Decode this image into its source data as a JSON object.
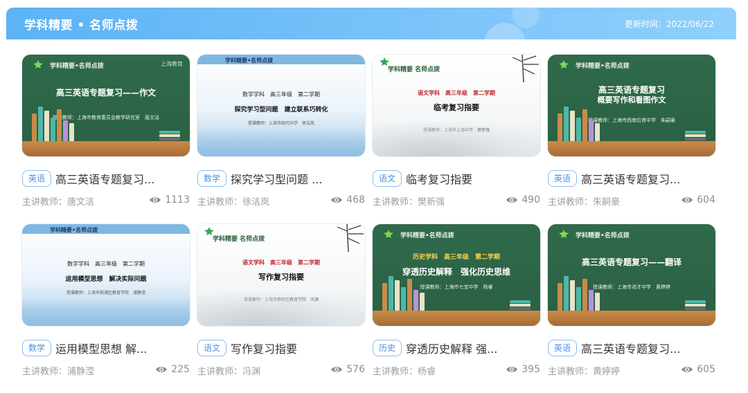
{
  "header": {
    "title": "学科精要 • 名师点拨",
    "updated": "更新时间：2022/06/22"
  },
  "courses": [
    {
      "tag": "英语",
      "title": "高三英语专题复习...",
      "teacher": "主讲教师：唐文洁",
      "views": "1113",
      "thumb": {
        "style": "green",
        "head": "学科精要•名师点拨",
        "corner": "上海教育",
        "main": "高三英语专题复习——作文",
        "sub": "授课教师：上海市教育委员会教学研究室　唐文洁"
      }
    },
    {
      "tag": "数学",
      "title": "探究学习型问题 ...",
      "teacher": "主讲教师：徐洁岚",
      "views": "468",
      "thumb": {
        "style": "blue",
        "head": "学科精要•名师点拨",
        "line1": "数学学科　高三年级　第二学期",
        "line2": "探究学习型问题　建立联系巧转化",
        "line3": "授课教师：上海市四代中学　徐洁岚"
      }
    },
    {
      "tag": "语文",
      "title": "临考复习指要",
      "teacher": "主讲教师：樊新强",
      "views": "490",
      "thumb": {
        "style": "ink",
        "head": "学科精要 名师点拨",
        "red": "语文学科　高三年级　第二学期",
        "main": "临考复习指要",
        "sub": "授课教师：上海市上海中学　樊新强"
      }
    },
    {
      "tag": "英语",
      "title": "高三英语专题复习...",
      "teacher": "主讲教师：朱嗣豪",
      "views": "604",
      "thumb": {
        "style": "green",
        "head": "学科精要•名师点拨",
        "main": "高三英语专题复习",
        "main2": "概要写作和看图作文",
        "sub": "授课教师：上海市西南位育中学　朱嗣豪"
      }
    },
    {
      "tag": "数学",
      "title": "运用模型思想 解...",
      "teacher": "主讲教师：浦静滢",
      "views": "225",
      "thumb": {
        "style": "blue",
        "head": "学科精要•名师点拨",
        "line1": "数学学科　高三年级　第二学期",
        "line2": "运用模型思想　解决实际问题",
        "line3": "授课教师：上海市杨浦区教育学院　浦静滢"
      }
    },
    {
      "tag": "语文",
      "title": "写作复习指要",
      "teacher": "主讲教师：冯渊",
      "views": "576",
      "thumb": {
        "style": "ink",
        "head": "学科精要 名师点拨",
        "red": "语文学科　高三年级　第二学期",
        "main": "写作复习指要",
        "sub": "授课教师：上海市静安区教育学院　冯渊"
      }
    },
    {
      "tag": "历史",
      "title": "穿透历史解释 强...",
      "teacher": "主讲教师：杨睿",
      "views": "395",
      "thumb": {
        "style": "green",
        "head": "学科精要•名师点拨",
        "red": "历史学科　高三年级　第二学期",
        "main": "穿透历史解释　强化历史思维",
        "sub": "授课教师：上海市七宝中学　杨睿"
      }
    },
    {
      "tag": "英语",
      "title": "高三英语专题复习...",
      "teacher": "主讲教师：黄婷婷",
      "views": "605",
      "thumb": {
        "style": "green",
        "head": "学科精要•名师点拨",
        "main": "高三英语专题复习——翻译",
        "sub": "授课教师：上海市进才中学　黄婷婷"
      }
    }
  ]
}
